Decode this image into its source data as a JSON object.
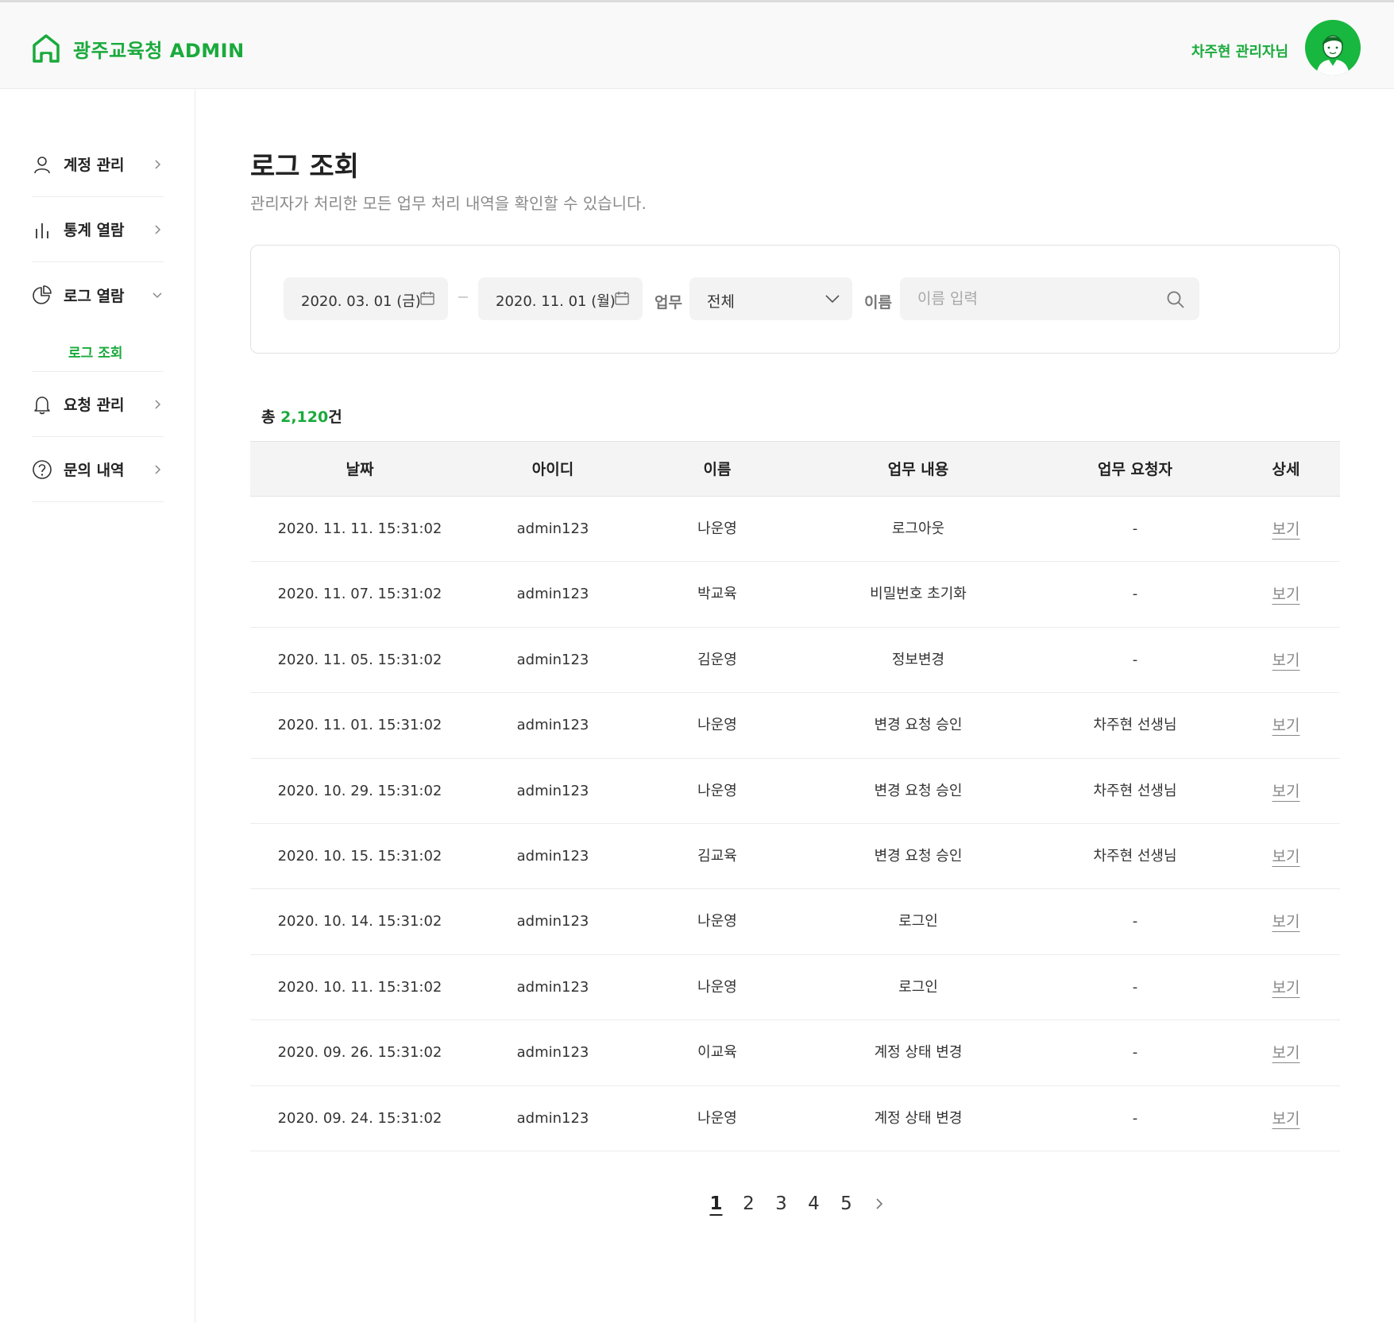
{
  "header": {
    "app_title": "광주교육청 ADMIN",
    "user_name": "차주현 관리자님"
  },
  "sidebar": {
    "items": [
      {
        "label": "계정 관리",
        "icon": "user-icon"
      },
      {
        "label": "통계 열람",
        "icon": "bar-chart-icon"
      },
      {
        "label": "로그 열람",
        "icon": "pie-chart-icon",
        "expanded": true
      },
      {
        "label": "요청 관리",
        "icon": "bell-icon"
      },
      {
        "label": "문의 내역",
        "icon": "question-icon"
      }
    ],
    "sub_item": "로그 조회"
  },
  "page": {
    "title": "로그 조회",
    "description": "관리자가 처리한 모든 업무 처리 내역을 확인할 수 있습니다."
  },
  "filters": {
    "start_date": "2020. 03. 01 (금)",
    "end_date": "2020. 11. 01 (월)",
    "task_label": "업무",
    "task_value": "전체",
    "name_label": "이름",
    "name_placeholder": "이름 입력"
  },
  "summary": {
    "prefix": "총",
    "count": "2,120",
    "suffix": "건"
  },
  "table": {
    "headers": [
      "날짜",
      "아이디",
      "이름",
      "업무 내용",
      "업무 요청자",
      "상세"
    ],
    "rows": [
      {
        "date": "2020. 11. 11. 15:31:02",
        "id": "admin123",
        "name": "나운영",
        "task": "로그아웃",
        "requester": "-",
        "detail": "보기"
      },
      {
        "date": "2020. 11. 07. 15:31:02",
        "id": "admin123",
        "name": "박교육",
        "task": "비밀번호 초기화",
        "requester": "-",
        "detail": "보기"
      },
      {
        "date": "2020. 11. 05. 15:31:02",
        "id": "admin123",
        "name": "김운영",
        "task": "정보변경",
        "requester": "-",
        "detail": "보기"
      },
      {
        "date": "2020. 11. 01. 15:31:02",
        "id": "admin123",
        "name": "나운영",
        "task": "변경 요청 승인",
        "requester": "차주현 선생님",
        "detail": "보기"
      },
      {
        "date": "2020. 10. 29. 15:31:02",
        "id": "admin123",
        "name": "나운영",
        "task": "변경 요청 승인",
        "requester": "차주현 선생님",
        "detail": "보기"
      },
      {
        "date": "2020. 10. 15. 15:31:02",
        "id": "admin123",
        "name": "김교육",
        "task": "변경 요청 승인",
        "requester": "차주현 선생님",
        "detail": "보기"
      },
      {
        "date": "2020. 10. 14. 15:31:02",
        "id": "admin123",
        "name": "나운영",
        "task": "로그인",
        "requester": "-",
        "detail": "보기"
      },
      {
        "date": "2020. 10. 11. 15:31:02",
        "id": "admin123",
        "name": "나운영",
        "task": "로그인",
        "requester": "-",
        "detail": "보기"
      },
      {
        "date": "2020. 09. 26. 15:31:02",
        "id": "admin123",
        "name": "이교육",
        "task": "계정 상태 변경",
        "requester": "-",
        "detail": "보기"
      },
      {
        "date": "2020. 09. 24. 15:31:02",
        "id": "admin123",
        "name": "나운영",
        "task": "계정 상태 변경",
        "requester": "-",
        "detail": "보기"
      }
    ]
  },
  "pagination": {
    "pages": [
      "1",
      "2",
      "3",
      "4",
      "5"
    ],
    "current": "1"
  },
  "colors": {
    "brand": "#1aaa3c",
    "avatar_bg": "#18b73f"
  }
}
